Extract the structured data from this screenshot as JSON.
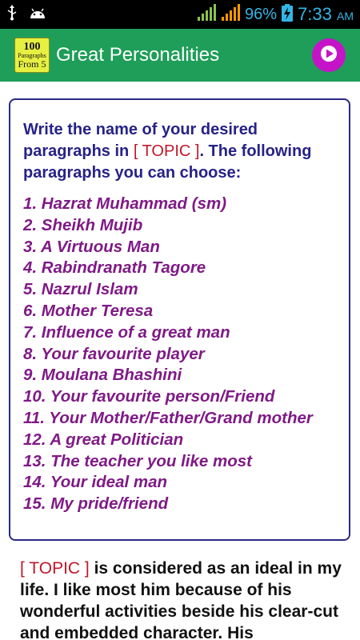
{
  "status_bar": {
    "battery_percent": "96%",
    "time": "7:33",
    "ampm": "AM",
    "icons": [
      "usb-icon",
      "android-icon",
      "wifi-signal-icon",
      "cell-signal-icon",
      "battery-charging-icon"
    ],
    "accent_color": "#33b5e5"
  },
  "app_bar": {
    "logo_lines": [
      "100",
      "Paragraphs",
      "From 5"
    ],
    "title": "Great Personalities",
    "play_icon": "play-icon",
    "background_color": "#1e9e58",
    "play_color": "#c514c8"
  },
  "card": {
    "intro_before": "Write the name of your desired paragraphs in ",
    "topic_token": "[ TOPIC ]",
    "intro_after": ". The following paragraphs you can choose:",
    "topics": [
      "1. Hazrat Muhammad (sm)",
      "2. Sheikh Mujib",
      "3. A Virtuous Man",
      "4. Rabindranath Tagore",
      "5. Nazrul Islam",
      "6. Mother Teresa",
      "7. Influence of a great man",
      "8. Your favourite player",
      "9. Moulana Bhashini",
      "10. Your favourite person/Friend",
      "11. Your Mother/Father/Grand mother",
      "12. A great Politician",
      "13. The teacher you like most",
      "14. Your ideal man",
      "15. My pride/friend"
    ]
  },
  "paragraph": {
    "topic_token": "[ TOPIC ]",
    "text": " is considered as an ideal in my life. I like most him because of his wonderful activities beside his clear-cut and embedded character. His"
  }
}
